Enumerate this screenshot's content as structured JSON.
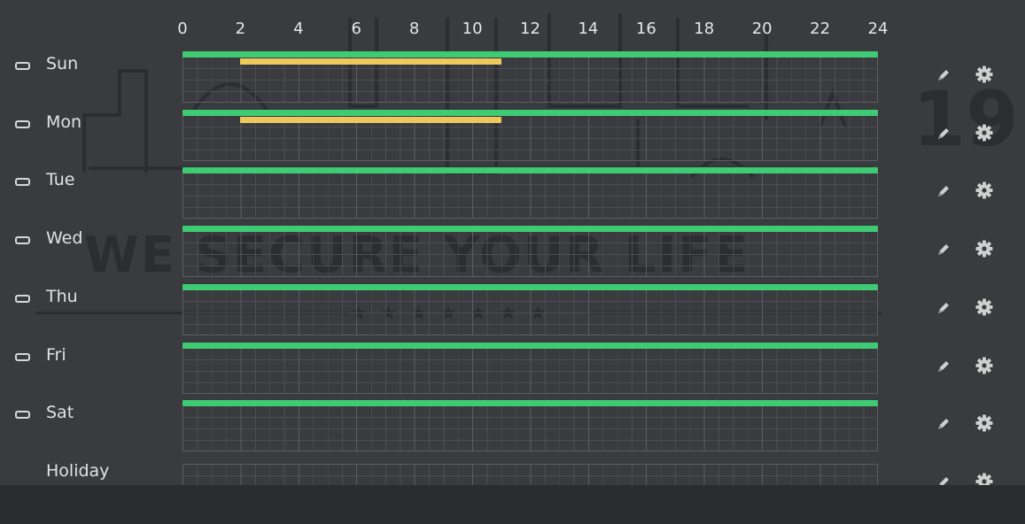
{
  "watermark": {
    "tagline": "WE SECURE YOUR LIFE",
    "year_fragment": "19"
  },
  "hour_axis": [
    "0",
    "2",
    "4",
    "6",
    "8",
    "10",
    "12",
    "14",
    "16",
    "18",
    "20",
    "22",
    "24"
  ],
  "colors": {
    "background": "#3a3b3f",
    "green_schedule": "#3ecb74",
    "yellow_schedule": "#ecc95a",
    "grid_line": "#5c5d62",
    "bottom_bar": "#2b2c2f"
  },
  "rows": [
    {
      "label": "Sun",
      "checkbox": true,
      "checked": false,
      "green": [
        [
          0,
          24
        ]
      ],
      "yellow": [
        [
          2,
          11
        ]
      ]
    },
    {
      "label": "Mon",
      "checkbox": true,
      "checked": false,
      "green": [
        [
          0,
          24
        ]
      ],
      "yellow": [
        [
          2,
          11
        ]
      ]
    },
    {
      "label": "Tue",
      "checkbox": true,
      "checked": false,
      "green": [
        [
          0,
          24
        ]
      ],
      "yellow": []
    },
    {
      "label": "Wed",
      "checkbox": true,
      "checked": false,
      "green": [
        [
          0,
          24
        ]
      ],
      "yellow": []
    },
    {
      "label": "Thu",
      "checkbox": true,
      "checked": false,
      "green": [
        [
          0,
          24
        ]
      ],
      "yellow": []
    },
    {
      "label": "Fri",
      "checkbox": true,
      "checked": false,
      "green": [
        [
          0,
          24
        ]
      ],
      "yellow": []
    },
    {
      "label": "Sat",
      "checkbox": true,
      "checked": false,
      "green": [
        [
          0,
          24
        ]
      ],
      "yellow": []
    },
    {
      "label": "Holiday",
      "checkbox": false,
      "checked": false,
      "green": [],
      "yellow": []
    }
  ],
  "row_actions": {
    "edit_icon": "pencil-icon",
    "setting_icon": "gear-icon"
  }
}
